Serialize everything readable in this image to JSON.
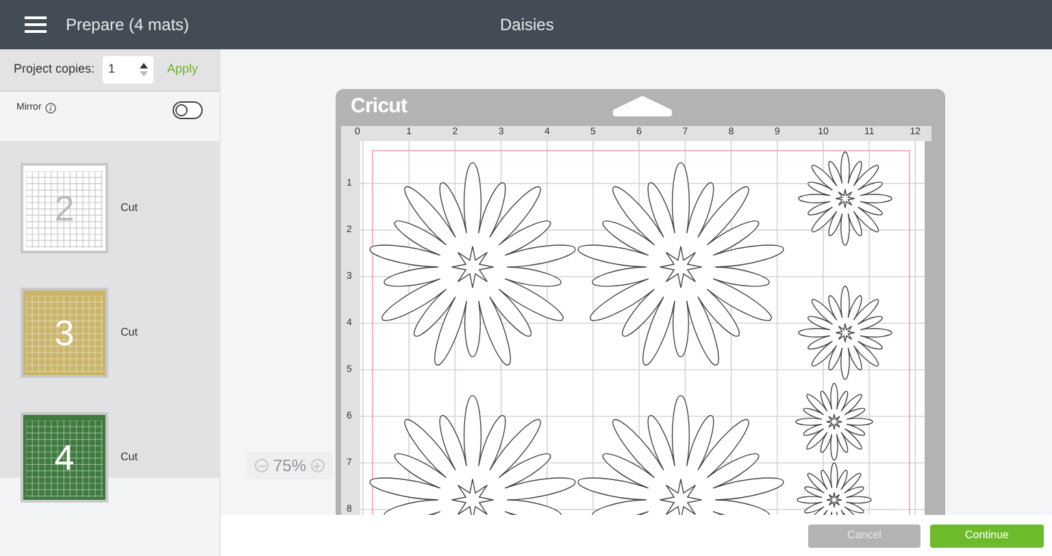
{
  "header": {
    "title": "Prepare (4 mats)",
    "project": "Daisies"
  },
  "copies": {
    "label": "Project copies:",
    "value": "1",
    "apply": "Apply"
  },
  "mirror": {
    "label": "Mirror",
    "on": false
  },
  "mats": [
    {
      "number": "2",
      "label": "Cut",
      "color": "#ffffff"
    },
    {
      "number": "3",
      "label": "Cut",
      "color": "#c9b56b"
    },
    {
      "number": "4",
      "label": "Cut",
      "color": "#3f7a3f"
    }
  ],
  "mat": {
    "logo": "Cricut",
    "x_ruler": [
      "0",
      "1",
      "2",
      "3",
      "4",
      "5",
      "6",
      "7",
      "8",
      "9",
      "10",
      "11",
      "12"
    ],
    "y_ruler": [
      "1",
      "2",
      "3",
      "4",
      "5",
      "6",
      "7",
      "8"
    ]
  },
  "zoom": {
    "value": "75%"
  },
  "buttons": {
    "cancel": "Cancel",
    "continue": "Continue"
  }
}
